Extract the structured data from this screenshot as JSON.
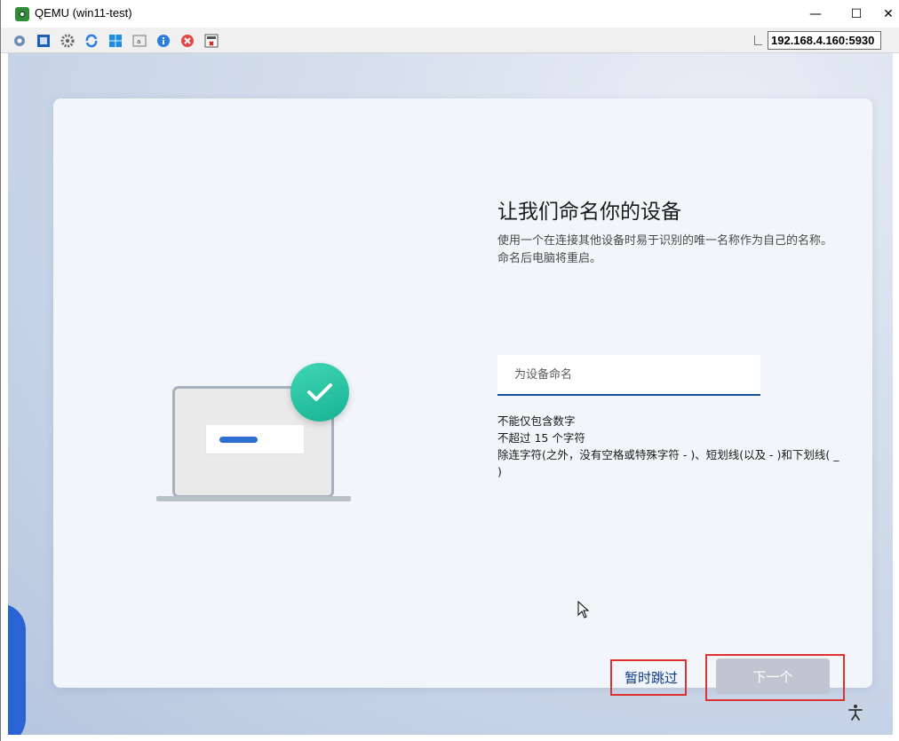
{
  "window": {
    "title": "QEMU (win11-test)",
    "minimize_label": "—",
    "maximize_label": "☐",
    "close_label": "✕"
  },
  "toolbar": {
    "icons": [
      "network-icon",
      "fullscreen-icon",
      "settings-icon",
      "refresh-icon",
      "windows-key-icon",
      "keyboard-icon",
      "info-icon",
      "stop-icon",
      "screenshot-icon"
    ],
    "address": "192.168.4.160:5930"
  },
  "oobe": {
    "heading": "让我们命名你的设备",
    "description": "使用一个在连接其他设备时易于识别的唯一名称作为自己的名称。命名后电脑将重启。",
    "input_placeholder": "为设备命名",
    "input_value": "",
    "rules": [
      "不能仅包含数字",
      "不超过 15 个字符",
      "除连字符(之外，没有空格或特殊字符 - )、短划线(以及 - )和下划线( _ )"
    ],
    "skip_label": "暂时跳过",
    "next_label": "下一个",
    "next_enabled": false
  },
  "colors": {
    "accent": "#1a4f9c",
    "check_badge": "#1fbf9c",
    "highlight_box": "#e03030"
  }
}
